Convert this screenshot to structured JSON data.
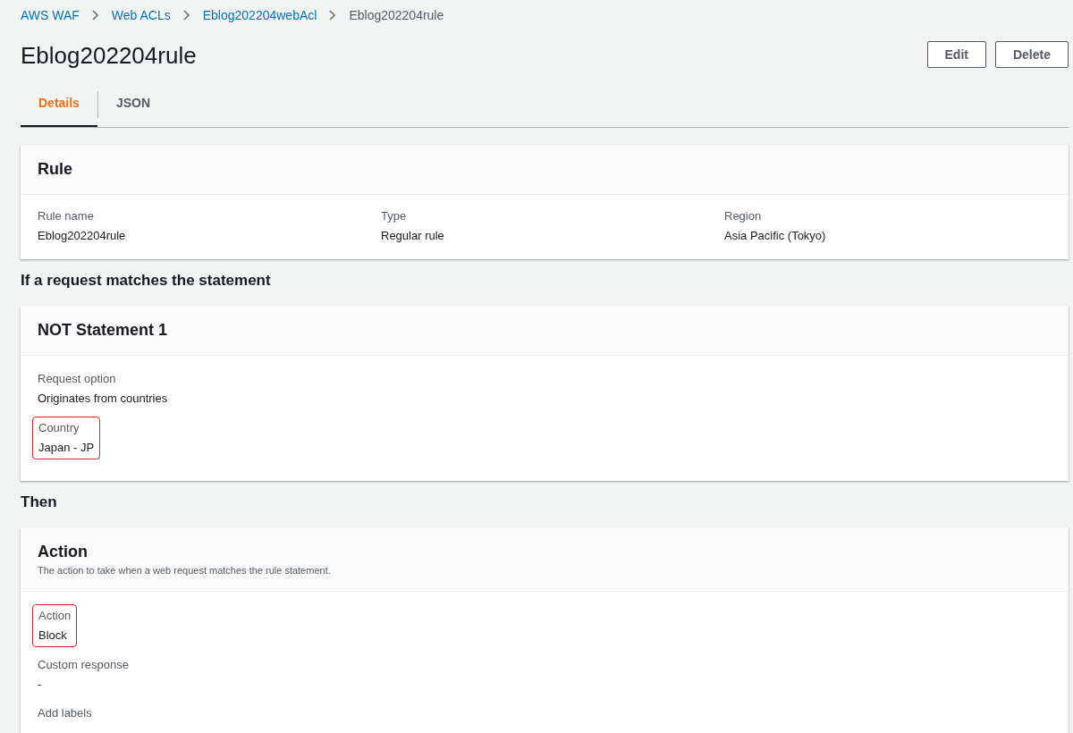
{
  "breadcrumbs": [
    {
      "label": "AWS WAF",
      "link": true
    },
    {
      "label": "Web ACLs",
      "link": true
    },
    {
      "label": "Eblog202204webAcl",
      "link": true
    },
    {
      "label": "Eblog202204rule",
      "link": false
    }
  ],
  "title": "Eblog202204rule",
  "buttons": [
    "Edit",
    "Delete"
  ],
  "tabs": [
    {
      "label": "Details",
      "selected": true
    },
    {
      "label": "JSON",
      "selected": false
    }
  ],
  "rule_card": {
    "title": "Rule",
    "fields": [
      {
        "label": "Rule name",
        "value": "Eblog202204rule"
      },
      {
        "label": "Type",
        "value": "Regular rule"
      },
      {
        "label": "Region",
        "value": "Asia Pacific (Tokyo)"
      }
    ]
  },
  "statement_heading": "If a request matches the statement",
  "statement_card": {
    "title": "NOT Statement 1",
    "fields": [
      {
        "label": "Request option",
        "value": "Originates from countries",
        "highlighted": false
      },
      {
        "label": "Country",
        "value": "Japan - JP",
        "highlighted": true
      }
    ]
  },
  "then_heading": "Then",
  "action_card": {
    "title": "Action",
    "description": "The action to take when a web request matches the rule statement.",
    "fields": [
      {
        "label": "Action",
        "value": "Block",
        "highlighted": true
      },
      {
        "label": "Custom response",
        "value": "-",
        "highlighted": false
      },
      {
        "label": "Add labels",
        "highlighted": false
      }
    ]
  }
}
